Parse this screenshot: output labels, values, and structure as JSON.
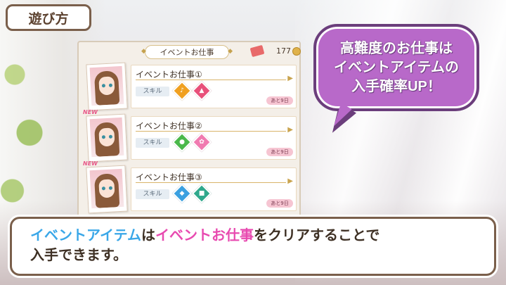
{
  "title_tab": "遊び方",
  "panel": {
    "header": "イベントお仕事",
    "ticket_count": "177",
    "rows": [
      {
        "new": "",
        "title": "イベントお仕事①",
        "skill_label": "スキル",
        "days": "あと9日",
        "skills": [
          {
            "icon": "vocal-icon",
            "color": "#f0a020",
            "glyph": "♪"
          },
          {
            "icon": "hat-icon",
            "color": "#e8507a",
            "glyph": "▲"
          }
        ]
      },
      {
        "new": "NEW",
        "title": "イベントお仕事②",
        "skill_label": "スキル",
        "days": "あと9日",
        "skills": [
          {
            "icon": "camera-icon",
            "color": "#4ab84a",
            "glyph": "●"
          },
          {
            "icon": "ribbon-icon",
            "color": "#f07ab0",
            "glyph": "✿"
          }
        ]
      },
      {
        "new": "NEW",
        "title": "イベントお仕事③",
        "skill_label": "スキル",
        "days": "あと9日",
        "skills": [
          {
            "icon": "lamp-icon",
            "color": "#3aa0e0",
            "glyph": "◆"
          },
          {
            "icon": "stage-icon",
            "color": "#2fa88c",
            "glyph": "■"
          }
        ]
      }
    ]
  },
  "bubble": {
    "line1": "高難度のお仕事は",
    "line2": "イベントアイテムの",
    "line3": "入手確率UP！"
  },
  "description": {
    "part1": "イベントアイテム",
    "part2": "は",
    "part3": "イベントお仕事",
    "part4": "をクリアすることで",
    "line2": "入手できます。"
  },
  "colors": {
    "accent_blue": "#3aa7e8",
    "accent_pink": "#e84ab0",
    "bubble_purple": "#b869c9",
    "frame_brown": "#7a5f4b"
  }
}
